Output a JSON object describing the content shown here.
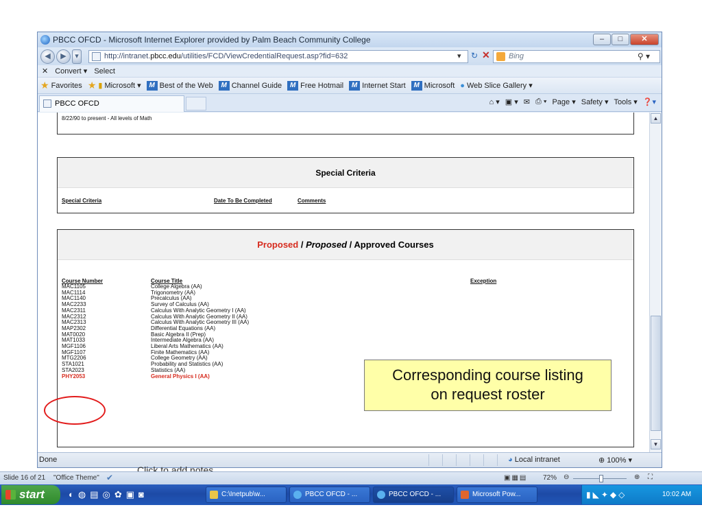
{
  "window": {
    "title": "PBCC OFCD - Microsoft Internet Explorer provided by Palm Beach Community College"
  },
  "address_bar": {
    "url_prefix": "http://intranet.",
    "url_domain": "pbcc.edu",
    "url_path": "/utilities/FCD/ViewCredentialRequest.asp?fid=632",
    "search_placeholder": "Bing"
  },
  "command_bar": {
    "convert_label": "Convert ▾",
    "select_label": "Select"
  },
  "favorites_bar": {
    "favorites_label": "Favorites",
    "items": [
      "Microsoft ▾",
      "Best of the Web",
      "Channel Guide",
      "Free Hotmail",
      "Internet Start",
      "Microsoft",
      "Web Slice Gallery ▾"
    ]
  },
  "tabs": {
    "active_tab_label": "PBCC OFCD",
    "tools": [
      "Page ▾",
      "Safety ▾",
      "Tools ▾"
    ]
  },
  "page": {
    "top_fragment": "8/22/90 to present - All levels of Math",
    "special_criteria": {
      "heading": "Special Criteria",
      "col1": "Special Criteria",
      "col2": "Date To Be Completed",
      "col3": "Comments"
    },
    "courses": {
      "heading_part1": "Proposed",
      "heading_sep1": " / ",
      "heading_part2": "Proposed",
      "heading_sep2": " / ",
      "heading_part3": "Approved Courses",
      "col_number": "Course Number",
      "col_title": "Course Title",
      "col_exception": "Exception",
      "rows": [
        {
          "number": "MAC1105",
          "title": "College Algebra (AA)"
        },
        {
          "number": "MAC1114",
          "title": "Trigonometry (AA)"
        },
        {
          "number": "MAC1140",
          "title": "Precalculus (AA)"
        },
        {
          "number": "MAC2233",
          "title": "Survey of Calculus (AA)"
        },
        {
          "number": "MAC2311",
          "title": "Calculus With Analytic Geometry I (AA)"
        },
        {
          "number": "MAC2312",
          "title": "Calculus With Analytic Geometry II (AA)"
        },
        {
          "number": "MAC2313",
          "title": "Calculus With Analytic Geometry III (AA)"
        },
        {
          "number": "MAP2302",
          "title": "Differential Equations (AA)"
        },
        {
          "number": "MAT0020",
          "title": "Basic Algebra II (Prep)"
        },
        {
          "number": "MAT1033",
          "title": "Intermediate Algebra (AA)"
        },
        {
          "number": "MGF1106",
          "title": "Liberal Arts Mathematics (AA)"
        },
        {
          "number": "MGF1107",
          "title": "Finite Mathematics (AA)"
        },
        {
          "number": "MTG2206",
          "title": "College Geometry (AA)"
        },
        {
          "number": "STA1021",
          "title": "Probability and Statistics (AA)"
        },
        {
          "number": "STA2023",
          "title": "Statistics (AA)"
        }
      ],
      "highlight_row": {
        "number": "PHY2053",
        "title": "General Physics I (AA)"
      }
    }
  },
  "callout": {
    "line1": "Corresponding course listing",
    "line2": "on request roster"
  },
  "status_bar": {
    "done": "Done",
    "zone": "Local intranet",
    "zoom": "100%"
  },
  "ppt": {
    "notes_placeholder": "Click to add notes",
    "slide_info": "Slide 16 of 21",
    "theme": "\"Office Theme\"",
    "zoom": "72%"
  },
  "taskbar": {
    "start_label": "start",
    "tasks": [
      "C:\\Inetpub\\w...",
      "PBCC OFCD - ...",
      "PBCC OFCD - ...",
      "Microsoft Pow..."
    ],
    "clock": "10:02 AM"
  },
  "colors": {
    "accent_red": "#d62b1e",
    "callout_bg": "#ffffa8",
    "taskbar_blue": "#2157b8"
  }
}
